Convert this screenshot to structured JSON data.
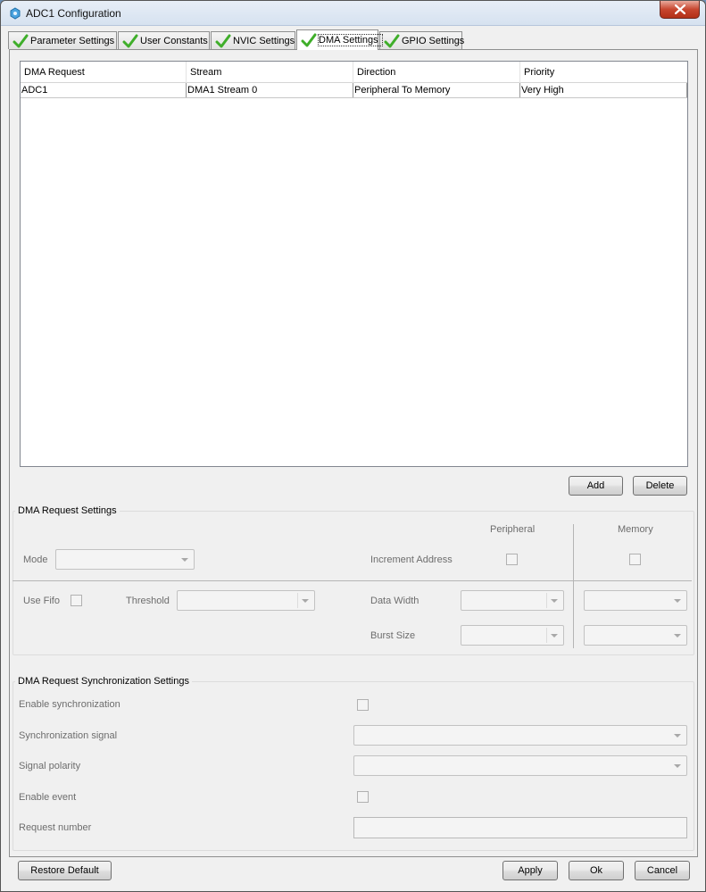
{
  "window": {
    "title": "ADC1 Configuration",
    "close_icon": "close-icon"
  },
  "tabs": [
    {
      "label": "Parameter Settings",
      "icon": "checkmark-icon",
      "active": false
    },
    {
      "label": "User Constants",
      "icon": "checkmark-icon",
      "active": false
    },
    {
      "label": "NVIC Settings",
      "icon": "checkmark-icon",
      "active": false
    },
    {
      "label": "DMA Settings",
      "icon": "checkmark-icon",
      "active": true
    },
    {
      "label": "GPIO Settings",
      "icon": "checkmark-icon",
      "active": false
    }
  ],
  "dma_table": {
    "columns": [
      "DMA Request",
      "Stream",
      "Direction",
      "Priority"
    ],
    "rows": [
      [
        "ADC1",
        "DMA1 Stream 0",
        "Peripheral To Memory",
        "Very High"
      ]
    ]
  },
  "table_buttons": {
    "add": "Add",
    "delete": "Delete"
  },
  "request_settings": {
    "title": "DMA Request Settings",
    "peripheral_header": "Peripheral",
    "memory_header": "Memory",
    "mode_label": "Mode",
    "mode_value": "",
    "increment_address_label": "Increment Address",
    "use_fifo_label": "Use Fifo",
    "threshold_label": "Threshold",
    "threshold_value": "",
    "data_width_label": "Data Width",
    "burst_size_label": "Burst Size"
  },
  "sync_settings": {
    "title": "DMA Request Synchronization Settings",
    "enable_sync_label": "Enable synchronization",
    "sync_signal_label": "Synchronization signal",
    "signal_polarity_label": "Signal polarity",
    "enable_event_label": "Enable event",
    "request_number_label": "Request number",
    "request_number_value": ""
  },
  "footer": {
    "restore_default": "Restore Default",
    "apply": "Apply",
    "ok": "Ok",
    "cancel": "Cancel"
  },
  "colors": {
    "check_green": "#3fae2a",
    "close_red": "#c7462f",
    "disabled_text": "#6d6d6d"
  }
}
